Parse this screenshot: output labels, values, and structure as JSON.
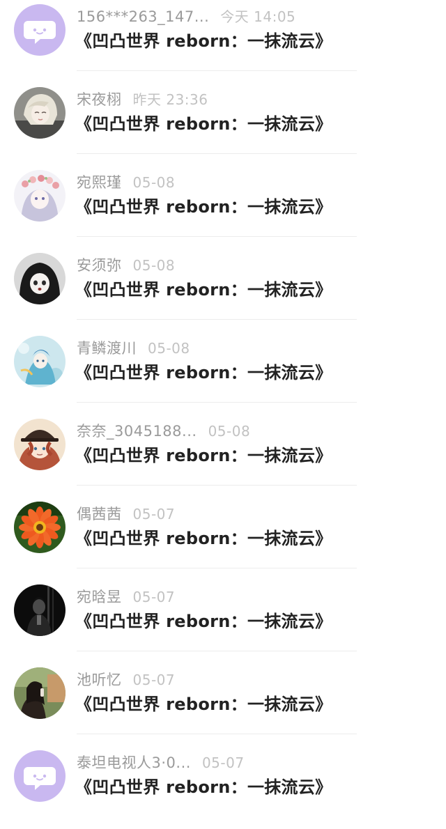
{
  "comments": [
    {
      "user": "156***263_147...",
      "time": "今天 14:05",
      "text": "《凹凸世界 reborn：一抹流云》",
      "avatar": "default-chat-avatar"
    },
    {
      "user": "宋夜栩",
      "time": "昨天 23:36",
      "text": "《凹凸世界 reborn：一抹流云》",
      "avatar": "anime-girl-avatar"
    },
    {
      "user": "宛熙瑾",
      "time": "05-08",
      "text": "《凹凸世界 reborn：一抹流云》",
      "avatar": "anime-flower-crown-avatar"
    },
    {
      "user": "安须弥",
      "time": "05-08",
      "text": "《凹凸世界 reborn：一抹流云》",
      "avatar": "anime-dark-hair-avatar"
    },
    {
      "user": "青鳞渡川",
      "time": "05-08",
      "text": "《凹凸世界 reborn：一抹流云》",
      "avatar": "anime-blue-avatar"
    },
    {
      "user": "奈奈_3045188...",
      "time": "05-08",
      "text": "《凹凸世界 reborn：一抹流云》",
      "avatar": "anime-hat-avatar"
    },
    {
      "user": "偶茜茜",
      "time": "05-07",
      "text": "《凹凸世界 reborn：一抹流云》",
      "avatar": "orange-flower-avatar"
    },
    {
      "user": "宛晗昱",
      "time": "05-07",
      "text": "《凹凸世界 reborn：一抹流云》",
      "avatar": "dark-figure-avatar"
    },
    {
      "user": "池听忆",
      "time": "05-07",
      "text": "《凹凸世界 reborn：一抹流云》",
      "avatar": "photo-girl-avatar"
    },
    {
      "user": "泰坦电视人3·0...",
      "time": "05-07",
      "text": "《凹凸世界 reborn：一抹流云》",
      "avatar": "default-chat-avatar"
    }
  ],
  "colors": {
    "default_avatar_bg": "#c9b8f0",
    "username": "#9a9a9a",
    "timestamp": "#c2c2c2",
    "content": "#222222",
    "divider": "#ececec"
  }
}
